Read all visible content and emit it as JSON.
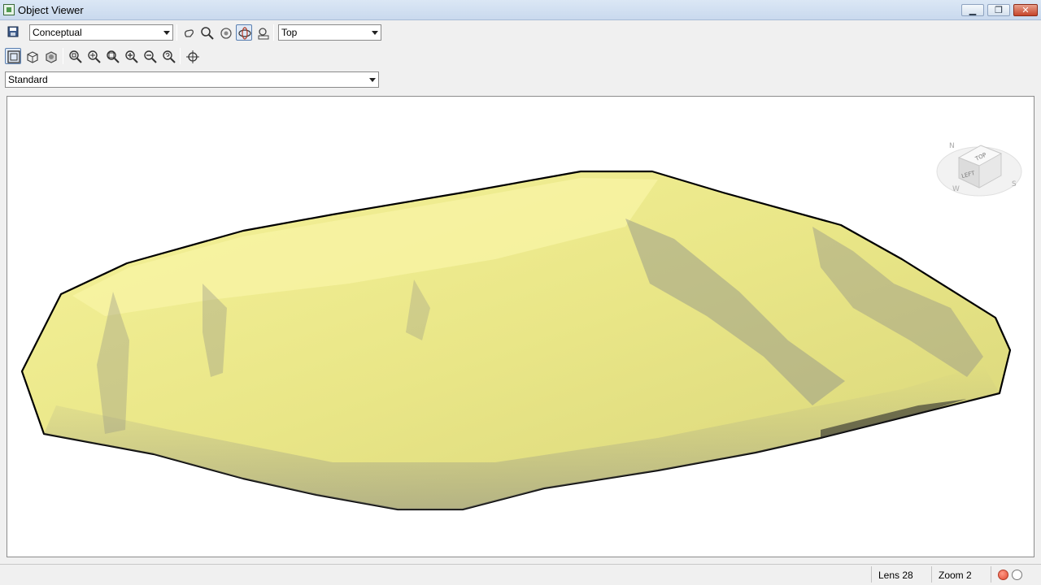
{
  "window": {
    "title": "Object Viewer",
    "minimize_glyph": "▁",
    "maximize_glyph": "❐",
    "close_glyph": "✕"
  },
  "toolbar": {
    "visual_style": "Conceptual",
    "view": "Top",
    "display": "Standard"
  },
  "viewcube": {
    "face_top": "TOP",
    "face_left": "LEFT",
    "compass": [
      "N",
      "W",
      "S"
    ]
  },
  "statusbar": {
    "lens": "Lens 28",
    "zoom": "Zoom 2"
  },
  "colors": {
    "surface_fill": "#f0ee8e",
    "surface_outline": "#000000",
    "viewport_bg": "#ffffff",
    "status_red": "#e04a32"
  }
}
